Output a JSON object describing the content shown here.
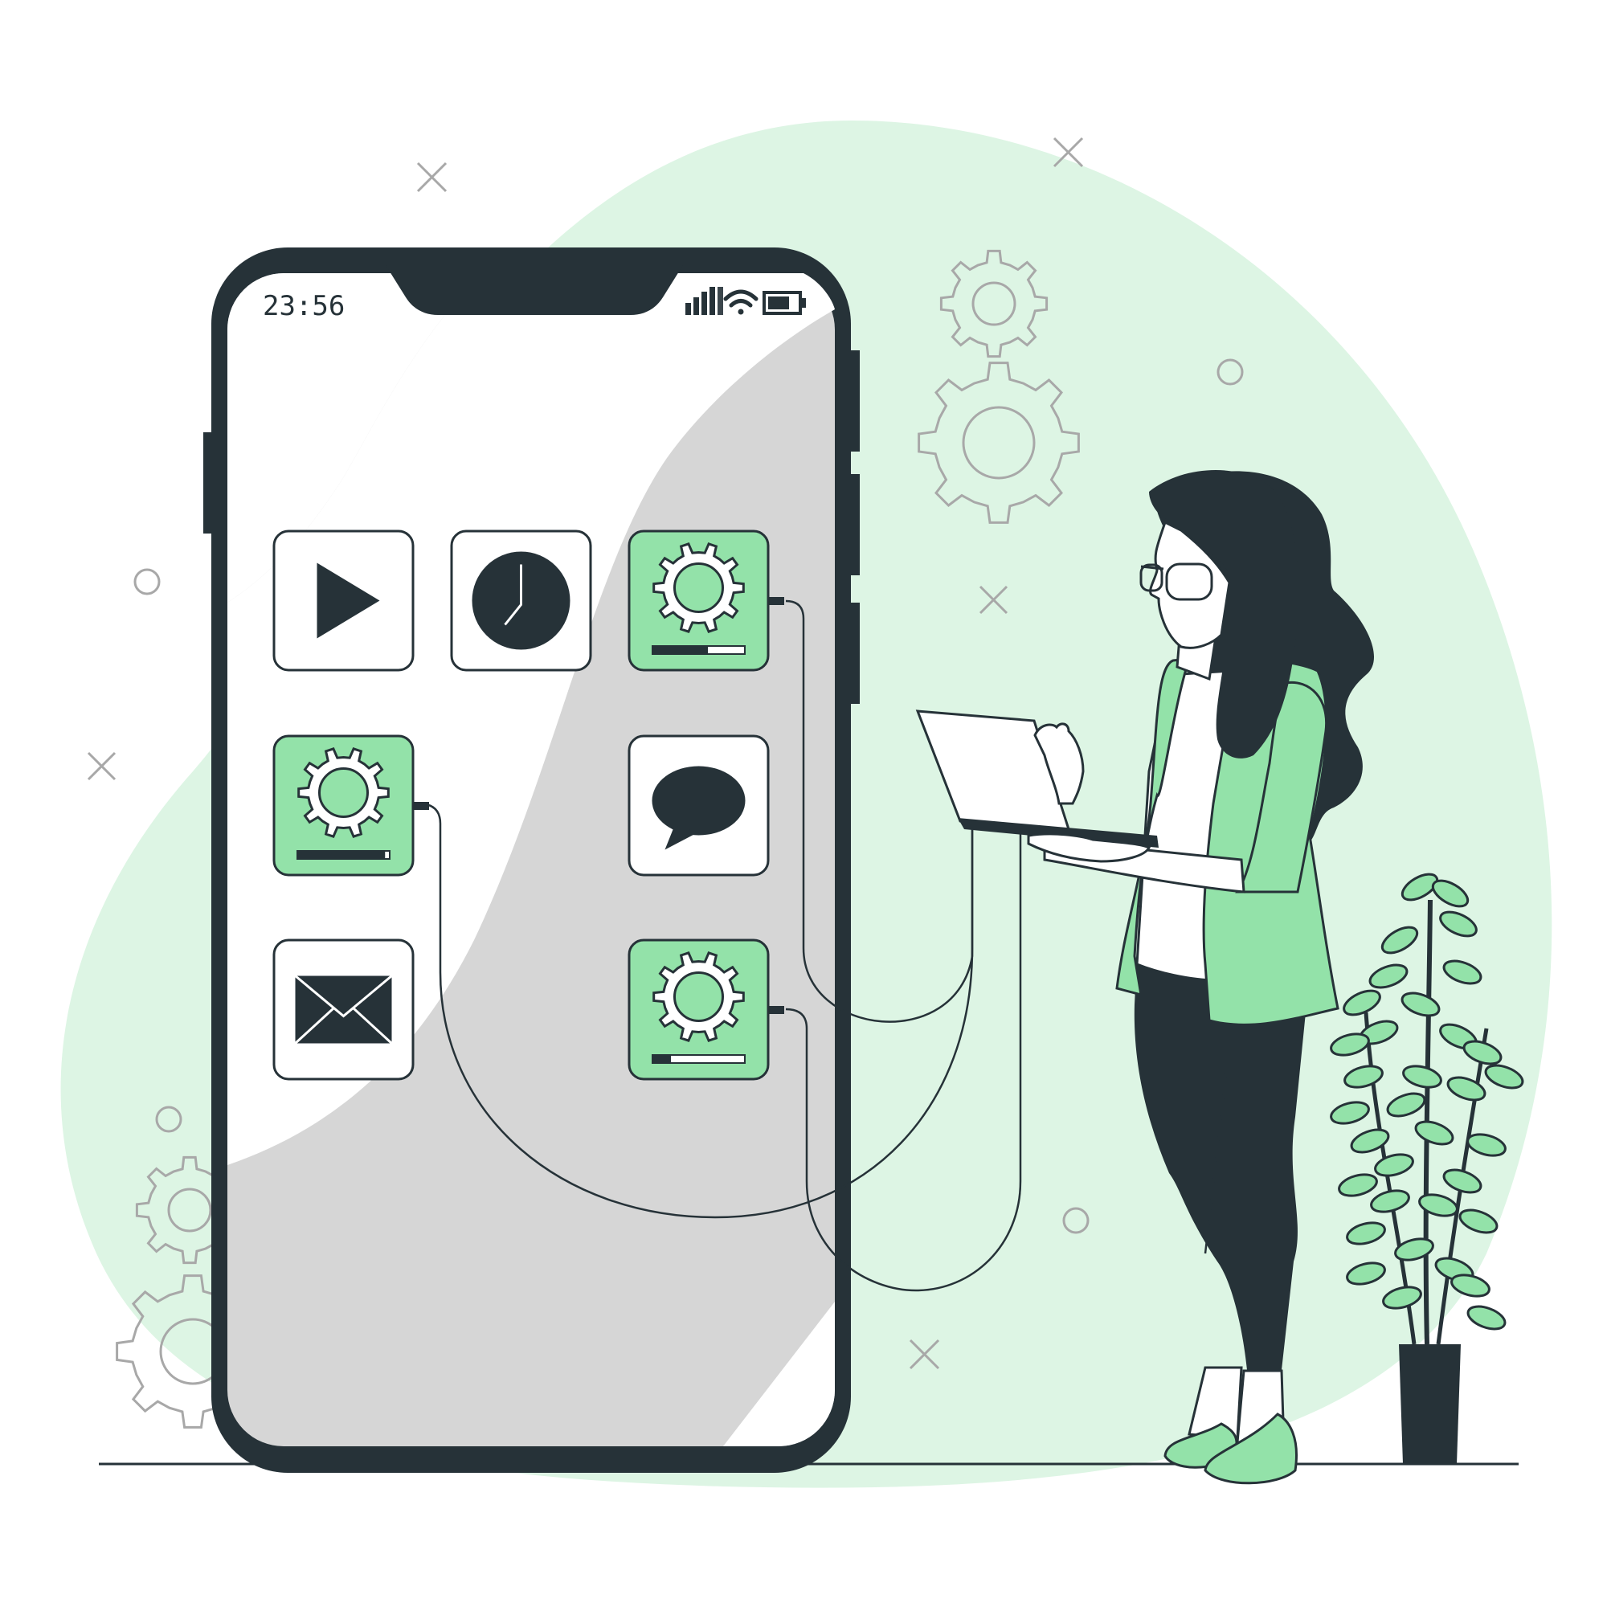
{
  "status_bar": {
    "time": "23:56",
    "icons": [
      "signal-bars-icon",
      "wifi-icon",
      "battery-icon"
    ]
  },
  "apps": [
    {
      "id": "play",
      "icon": "play-icon",
      "color": "#ffffff"
    },
    {
      "id": "clock",
      "icon": "clock-icon",
      "color": "#ffffff"
    },
    {
      "id": "settings-top",
      "icon": "gear-icon",
      "color": "#93e2a9",
      "progress": 0.6
    },
    {
      "id": "settings-mid",
      "icon": "gear-icon",
      "color": "#93e2a9",
      "progress": 0.95
    },
    {
      "id": "chat",
      "icon": "speech-bubble-icon",
      "color": "#ffffff"
    },
    {
      "id": "mail",
      "icon": "envelope-icon",
      "color": "#ffffff"
    },
    {
      "id": "settings-bottom",
      "icon": "gear-icon",
      "color": "#93e2a9",
      "progress": 0.2
    }
  ],
  "colors": {
    "accent": "#93e2a9",
    "background_blob": "#ddf5e4",
    "dark": "#263238",
    "screen_gray": "#d6d6d6"
  }
}
